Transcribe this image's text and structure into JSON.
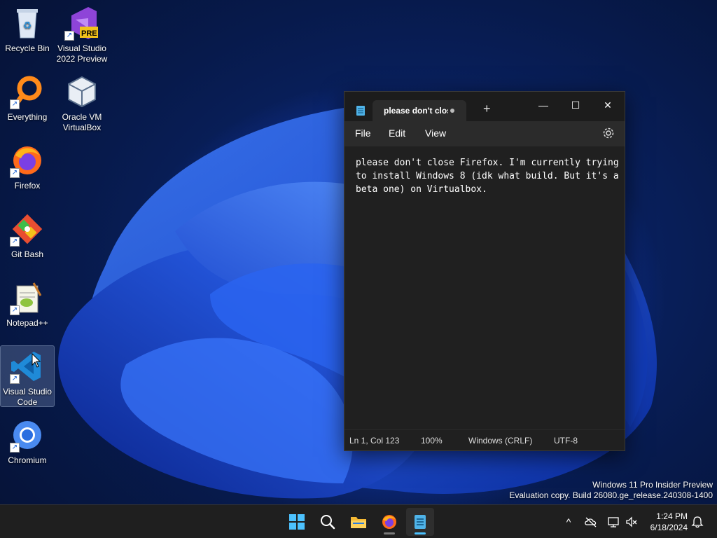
{
  "desktop": {
    "icons": [
      {
        "label": "Recycle Bin",
        "icon": "recycle-bin-icon"
      },
      {
        "label": "Visual Studio\n2022 Preview",
        "icon": "visual-studio-icon",
        "badge": "PRE"
      },
      {
        "label": "Everything",
        "icon": "everything-search-icon"
      },
      {
        "label": "Oracle VM\nVirtualBox",
        "icon": "virtualbox-icon"
      },
      {
        "label": "Firefox",
        "icon": "firefox-icon"
      },
      {
        "label": "Git Bash",
        "icon": "git-bash-icon"
      },
      {
        "label": "Notepad++",
        "icon": "notepad-plus-plus-icon"
      },
      {
        "label": "Visual Studio\nCode",
        "icon": "vscode-icon"
      },
      {
        "label": "Chromium",
        "icon": "chromium-icon"
      }
    ],
    "shortcut_glyph": "↗"
  },
  "notepad": {
    "tab_title": "please don't close Firefox",
    "new_tab_glyph": "+",
    "window_controls": {
      "minimize": "—",
      "maximize": "☐",
      "close": "✕"
    },
    "menu": {
      "file": "File",
      "edit": "Edit",
      "view": "View"
    },
    "content": "please don't close Firefox. I'm currently trying\nto install Windows 8 (idk what build. But it's a\nbeta one) on Virtualbox.",
    "status": {
      "position": "Ln 1, Col 123",
      "zoom": "100%",
      "line_ending": "Windows (CRLF)",
      "encoding": "UTF-8"
    }
  },
  "watermark": {
    "line1": "Windows 11 Pro Insider Preview",
    "line2": "Evaluation copy. Build 26080.ge_release.240308-1400"
  },
  "taskbar": {
    "apps": [
      "start-icon",
      "search-icon",
      "file-explorer-icon",
      "firefox-icon",
      "notepad-icon"
    ],
    "tray": {
      "chevron": "^"
    },
    "clock": {
      "time": "1:24 PM",
      "date": "6/18/2024"
    }
  },
  "colors": {
    "accent": "#4cc2ff",
    "wallpaper_blue": "#1e4fd8"
  }
}
